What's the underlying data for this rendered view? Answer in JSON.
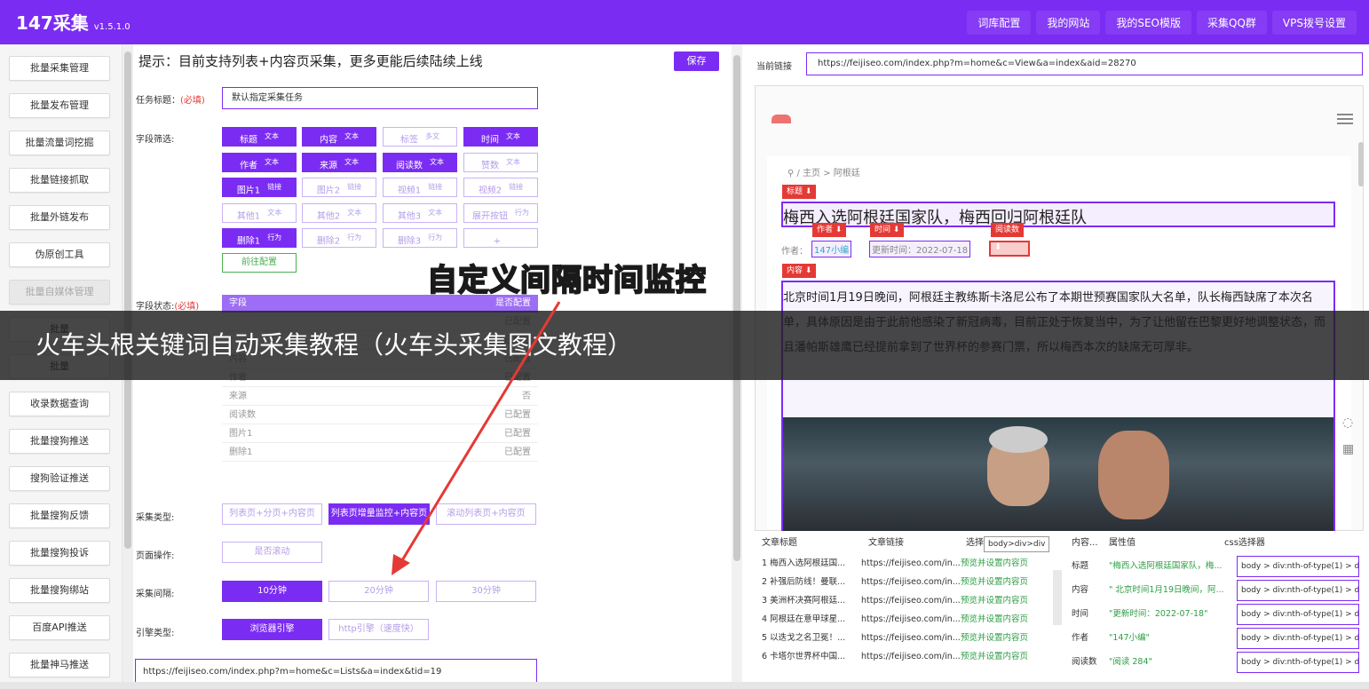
{
  "app": {
    "name": "147采集",
    "version": "v1.5.1.0"
  },
  "topnav": [
    "词库配置",
    "我的网站",
    "我的SEO模版",
    "采集QQ群",
    "VPS拨号设置"
  ],
  "sidebar": [
    "批量采集管理",
    "批量发布管理",
    "批量流量词挖掘",
    "批量链接抓取",
    "批量外链发布",
    "伪原创工具",
    "批量自媒体管理",
    "批量",
    "批量",
    "收录数据查询",
    "批量搜狗推送",
    "搜狗验证推送",
    "批量搜狗反馈",
    "批量搜狗投诉",
    "批量搜狗绑站",
    "百度API推送",
    "批量神马推送"
  ],
  "form": {
    "notice": "提示：目前支持列表+内容页采集，更多更能后续陆续上线",
    "save": "保存",
    "task_label": "任务标题：",
    "required": "(必填)",
    "task_value": "默认指定采集任务",
    "field_filter_label": "字段筛选:",
    "fields": [
      {
        "label": "标题",
        "tag": "文本"
      },
      {
        "label": "内容",
        "tag": "文本"
      },
      {
        "label": "标签",
        "tag": "多文"
      },
      {
        "label": "时间",
        "tag": "文本"
      },
      {
        "label": "作者",
        "tag": "文本"
      },
      {
        "label": "来源",
        "tag": "文本"
      },
      {
        "label": "阅读数",
        "tag": "文本"
      },
      {
        "label": "赞数",
        "tag": "文本"
      },
      {
        "label": "图片1",
        "tag": "链接"
      },
      {
        "label": "图片2",
        "tag": "链接"
      },
      {
        "label": "视频1",
        "tag": "链接"
      },
      {
        "label": "视频2",
        "tag": "链接"
      },
      {
        "label": "其他1",
        "tag": "文本"
      },
      {
        "label": "其他2",
        "tag": "文本"
      },
      {
        "label": "其他3",
        "tag": "文本"
      },
      {
        "label": "展开按钮",
        "tag": "行为"
      },
      {
        "label": "删除1",
        "tag": "行为"
      },
      {
        "label": "删除2",
        "tag": "行为"
      },
      {
        "label": "删除3",
        "tag": "行为"
      },
      {
        "label": "+",
        "tag": ""
      }
    ],
    "goto_config": "前往配置",
    "field_status_label": "字段状态:",
    "status_header": {
      "field": "字段",
      "configured": "是否配置"
    },
    "status_rows": [
      {
        "field": "",
        "status": "已配置"
      },
      {
        "field": "",
        "status": "已配置"
      },
      {
        "field": "内容",
        "status": "已配置"
      },
      {
        "field": "作者",
        "status": "已配置"
      },
      {
        "field": "来源",
        "status": "否"
      },
      {
        "field": "阅读数",
        "status": "已配置"
      },
      {
        "field": "图片1",
        "status": "已配置"
      },
      {
        "field": "删除1",
        "status": "已配置"
      }
    ],
    "collect_type_label": "采集类型:",
    "collect_types": [
      "列表页+分页+内容页",
      "列表页增量监控+内容页",
      "滚动列表页+内容页"
    ],
    "page_op_label": "页面操作:",
    "page_op": "是否滚动",
    "interval_label": "采集间隔:",
    "intervals": [
      "10分钟",
      "20分钟",
      "30分钟"
    ],
    "engine_label": "引擎类型:",
    "engines": [
      "浏览器引擎",
      "http引擎（速度快）"
    ],
    "list_url": "https://feijiseo.com/index.php?m=home&c=Lists&a=index&tid=19"
  },
  "overlay": {
    "banner": "火车头根关键词自动采集教程（火车头采集图文教程）",
    "caption": "自定义间隔时间监控"
  },
  "preview": {
    "current_label": "当前链接",
    "current_url": "https://feijiseo.com/index.php?m=home&c=View&a=index&aid=28270",
    "breadcrumb": "主页 > 阿根廷",
    "tags": {
      "title": "标题 ⬇",
      "author": "作者 ⬇",
      "time": "时间 ⬇",
      "reads": "阅读数",
      "content": "内容 ⬇",
      "reads_arrow": "⬇"
    },
    "headline": "梅西入选阿根廷国家队，梅西回归阿根廷队",
    "author_prefix": "作者：",
    "author": "147小编",
    "time": "更新时间：2022-07-18",
    "body": "北京时间1月19日晚间，阿根廷主教练斯卡洛尼公布了本期世预赛国家队大名单，队长梅西缺席了本次名单，具体原因是由于此前他感染了新冠病毒，目前正处于恢复当中，为了让他留在巴黎更好地调整状态，而且潘帕斯雄鹰已经提前拿到了世界杯的参赛门票，所以梅西本次的缺席无可厚非。"
  },
  "articles": {
    "headers": [
      "文章标题",
      "文章链接",
      "选择器"
    ],
    "tooltip": "body>div>div",
    "rows": [
      {
        "title": "1 梅西入选阿根廷国...",
        "link": "https://feijiseo.com/in...",
        "action": "预览并设置内容页"
      },
      {
        "title": "2 补强后防线！曼联...",
        "link": "https://feijiseo.com/in...",
        "action": "预览并设置内容页"
      },
      {
        "title": "3 美洲杯决赛阿根廷...",
        "link": "https://feijiseo.com/in...",
        "action": "预览并设置内容页"
      },
      {
        "title": "4 阿根廷在意甲球星...",
        "link": "https://feijiseo.com/in...",
        "action": "预览并设置内容页"
      },
      {
        "title": "5 以迭戈之名卫冕！...",
        "link": "https://feijiseo.com/in...",
        "action": "预览并设置内容页"
      },
      {
        "title": "6 卡塔尔世界杯中国...",
        "link": "https://feijiseo.com/in...",
        "action": "预览并设置内容页"
      }
    ]
  },
  "attributes": {
    "headers": [
      "内容...",
      "属性值",
      "css选择器"
    ],
    "rows": [
      {
        "name": "标题",
        "value": "\"梅西入选阿根廷国家队，梅...",
        "css": "body > div:nth-of-type(1) > d..."
      },
      {
        "name": "内容",
        "value": "\" 北京时间1月19日晚间，阿...",
        "css": "body > div:nth-of-type(1) > d..."
      },
      {
        "name": "时间",
        "value": "\"更新时间：2022-07-18\"",
        "css": "body > div:nth-of-type(1) > d..."
      },
      {
        "name": "作者",
        "value": "\"147小编\"",
        "css": "body > div:nth-of-type(1) > d..."
      },
      {
        "name": "阅读数",
        "value": "\"阅读 284\"",
        "css": "body > div:nth-of-type(1) > d..."
      }
    ]
  },
  "colors": {
    "accent": "#7b2cf3",
    "red": "#e53935",
    "green": "#2e9e45",
    "caption": "#ffe600"
  }
}
